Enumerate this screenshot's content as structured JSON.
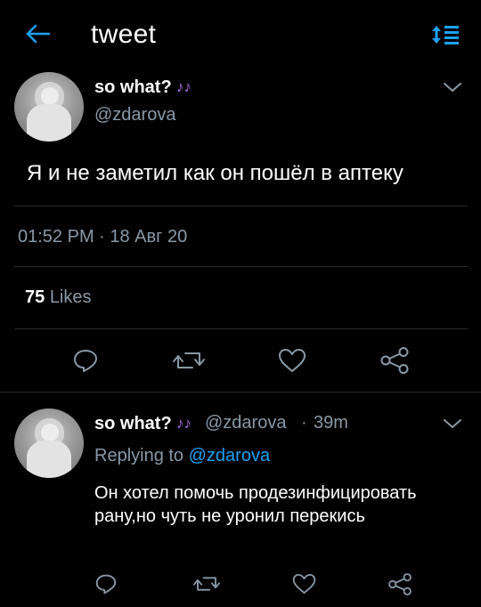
{
  "header": {
    "title": "tweet",
    "back_icon": "arrow-left-icon",
    "sort_icon": "sort-list-icon",
    "accent": "#1da1f2"
  },
  "tweet": {
    "author": {
      "name": "so what?",
      "name_emoji": "♪♪",
      "handle": "@zdarova",
      "avatar": "avatar-photo"
    },
    "text": "Я и не заметил как он пошёл в аптеку",
    "timestamp": "01:52 PM · 18 Авг 20",
    "likes_count": "75",
    "likes_label": "Likes",
    "actions": [
      "reply-icon",
      "retweet-icon",
      "like-icon",
      "share-icon"
    ]
  },
  "reply": {
    "author": {
      "name": "so what?",
      "name_emoji": "♪♪",
      "handle": "@zdarova",
      "age": "39m"
    },
    "replying_label": "Replying to",
    "replying_to": "@zdarova",
    "text": "Он хотел помочь продезинфицировать рану,но чуть не уронил перекись"
  },
  "colors": {
    "background": "#000000",
    "secondary_text": "#8899a6",
    "link": "#1da1f2",
    "note_emoji": "#b06ee8"
  }
}
